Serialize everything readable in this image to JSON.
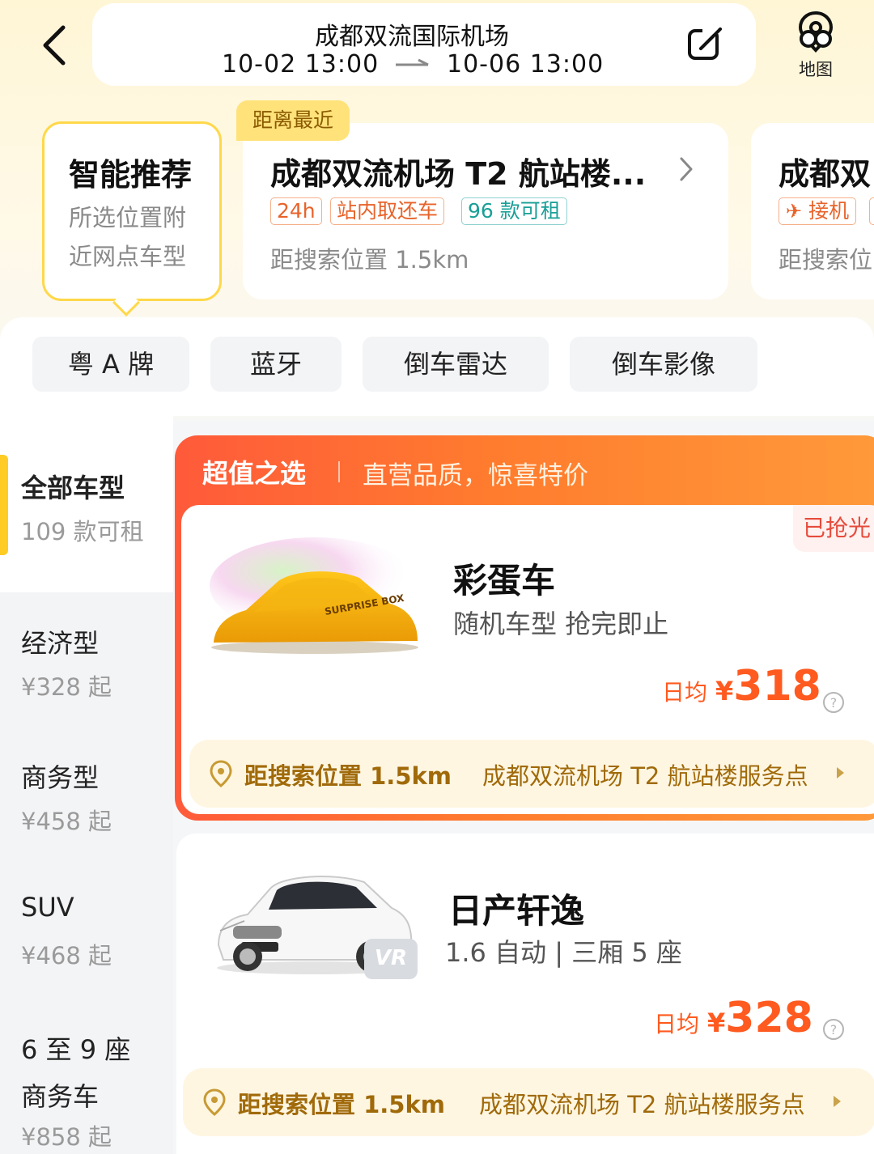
{
  "header": {
    "location": "成都双流国际机场",
    "pickup_time": "10-02 13:00",
    "return_time": "10-06 13:00",
    "map_label": "地图",
    "icons": [
      "back-arrow-icon",
      "edit-icon",
      "map-icon"
    ]
  },
  "recommend": {
    "smart": {
      "title": "智能推荐",
      "desc": "所选位置附近网点车型"
    },
    "store1": {
      "badge": "距离最近",
      "name": "成都双流机场 T2 航站楼...",
      "tags": [
        "24h",
        "站内取还车",
        "96 款可租"
      ],
      "distance": "距搜索位置 1.5km"
    },
    "store2": {
      "name": "成都双",
      "tag": "接机",
      "distance": "距搜索位"
    }
  },
  "filters": [
    "粤 A 牌",
    "蓝牙",
    "倒车雷达",
    "倒车影像"
  ],
  "categories": [
    {
      "name": "全部车型",
      "sub": "109 款可租"
    },
    {
      "name": "经济型",
      "sub": "¥328 起"
    },
    {
      "name": "商务型",
      "sub": "¥458 起"
    },
    {
      "name": "SUV",
      "sub": "¥468 起"
    },
    {
      "name": "6 至 9 座商务车",
      "sub": "¥858 起"
    }
  ],
  "promo": {
    "title": "超值之选",
    "subtitle": "直营品质，惊喜特价",
    "sold_out": "已抢光",
    "car": {
      "name": "彩蛋车",
      "desc": "随机车型 抢完即止",
      "price_label": "日均",
      "currency": "¥",
      "price": "318",
      "box_text": "SURPRISE BOX"
    },
    "location": {
      "distance": "距搜索位置 1.5km",
      "store": "成都双流机场 T2 航站楼服务点"
    }
  },
  "car2": {
    "name": "日产轩逸",
    "desc": "1.6 自动 | 三厢 5 座",
    "price_label": "日均",
    "currency": "¥",
    "price": "328",
    "vr": "VR",
    "location": {
      "distance": "距搜索位置 1.5km",
      "store": "成都双流机场 T2 航站楼服务点"
    }
  },
  "colors": {
    "accent": "#ffcc26",
    "price": "#ff5a1f",
    "promo": "#ff6a33",
    "location_text": "#a06a0a"
  }
}
